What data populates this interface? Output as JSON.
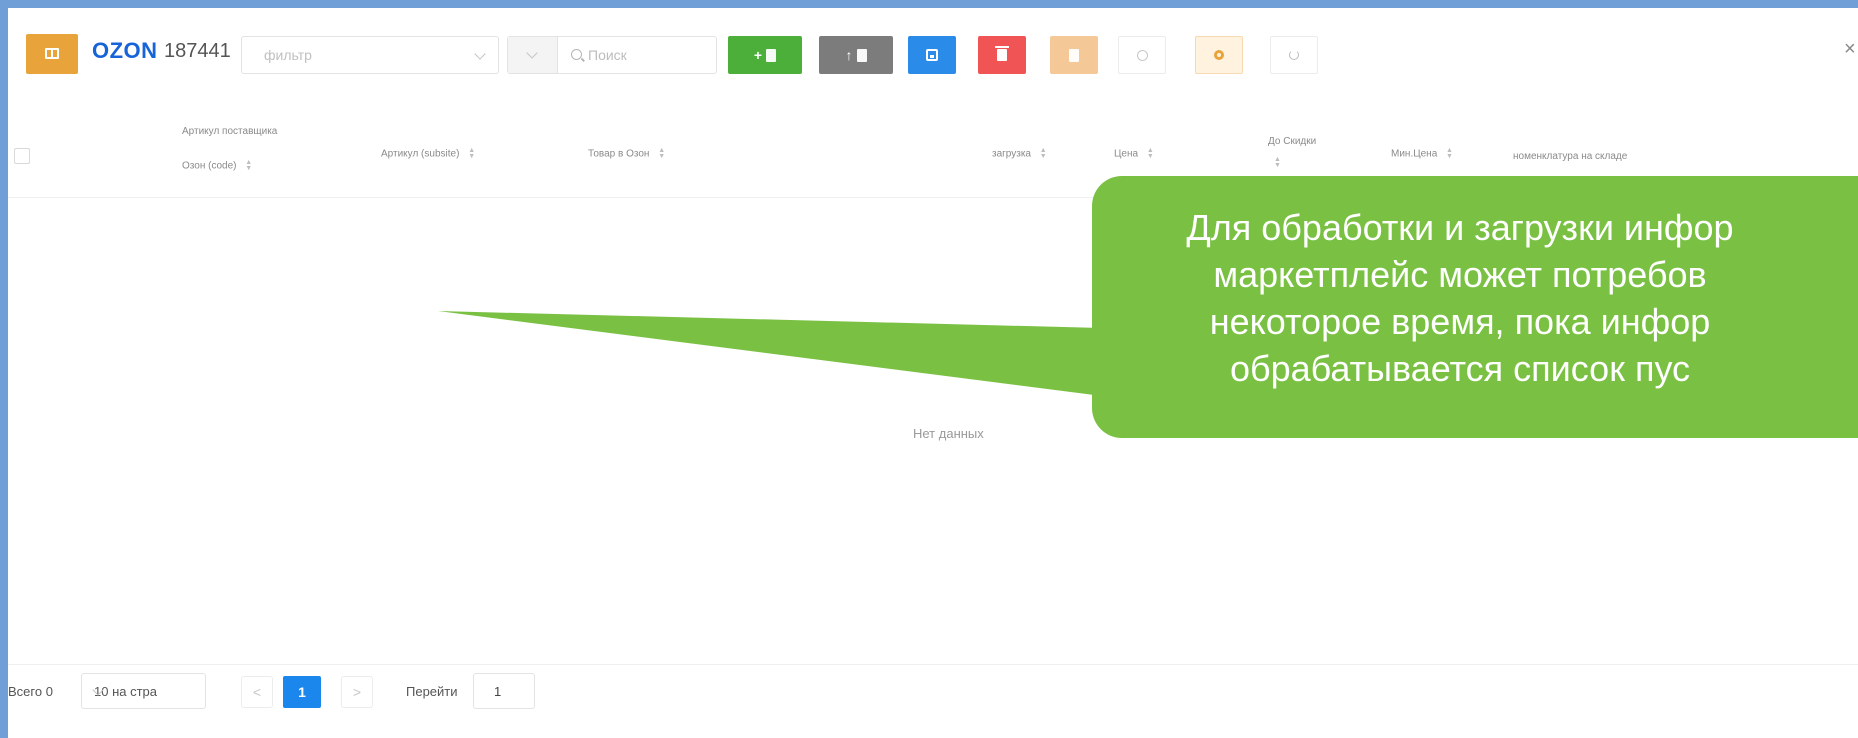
{
  "toolbar": {
    "logo": "OZON",
    "store_id": "187441",
    "filter_placeholder": "фильтр",
    "search_placeholder": "Поиск",
    "buttons": [
      {
        "name": "add",
        "color": "#4caf3a"
      },
      {
        "name": "upload",
        "color": "#7c7c7c"
      },
      {
        "name": "save",
        "color": "#2b8be8"
      },
      {
        "name": "delete",
        "color": "#f05454"
      },
      {
        "name": "document",
        "color": "#f4c997"
      },
      {
        "name": "settings-small",
        "color": "#ffffff"
      },
      {
        "name": "gear",
        "color": "#fff3e0"
      },
      {
        "name": "refresh",
        "color": "#ffffff"
      }
    ],
    "close_label": "×"
  },
  "table": {
    "columns": [
      {
        "line1": "Артикул поставщика",
        "line2": "Озон (code)"
      },
      {
        "label": "Артикул (subsite)"
      },
      {
        "label": "Товар в Озон"
      },
      {
        "label": "загрузка"
      },
      {
        "label": "Цена"
      },
      {
        "label": "До Скидки"
      },
      {
        "label": "Мин.Цена"
      },
      {
        "label": "номенклатура на складе"
      }
    ],
    "empty_text": "Нет данных"
  },
  "pagination": {
    "total": "Всего 0",
    "page_size": "10 на стра",
    "prev": "<",
    "current_page": "1",
    "next": ">",
    "goto_label": "Перейти",
    "goto_value": "1"
  },
  "callout": {
    "text": "Для обработки и загрузки инфор\nмаркетплейс может потребов\nнекоторое время, пока инфор\nобрабатывается список пус",
    "color": "#7ac143"
  }
}
